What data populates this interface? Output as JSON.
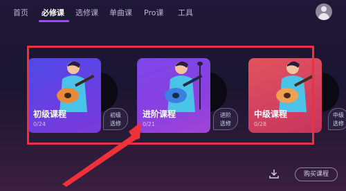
{
  "nav": {
    "tabs": [
      {
        "label": "首页"
      },
      {
        "label": "必修课"
      },
      {
        "label": "选修课"
      },
      {
        "label": "单曲课"
      },
      {
        "label": "Pro课"
      },
      {
        "label": "工具"
      }
    ],
    "active_index": 1
  },
  "cards": [
    {
      "title": "初级课程",
      "progress": "0/24",
      "elective": "初级\n选修"
    },
    {
      "title": "进阶课程",
      "progress": "0/21",
      "elective": "进阶\n选修"
    },
    {
      "title": "中级课程",
      "progress": "0/28",
      "elective": "中级\n选修"
    }
  ],
  "footer": {
    "buy_label": "购买课程",
    "download_icon": "download-icon"
  },
  "colors": {
    "accent": "#9a4cff",
    "annotation": "#f1313a"
  }
}
